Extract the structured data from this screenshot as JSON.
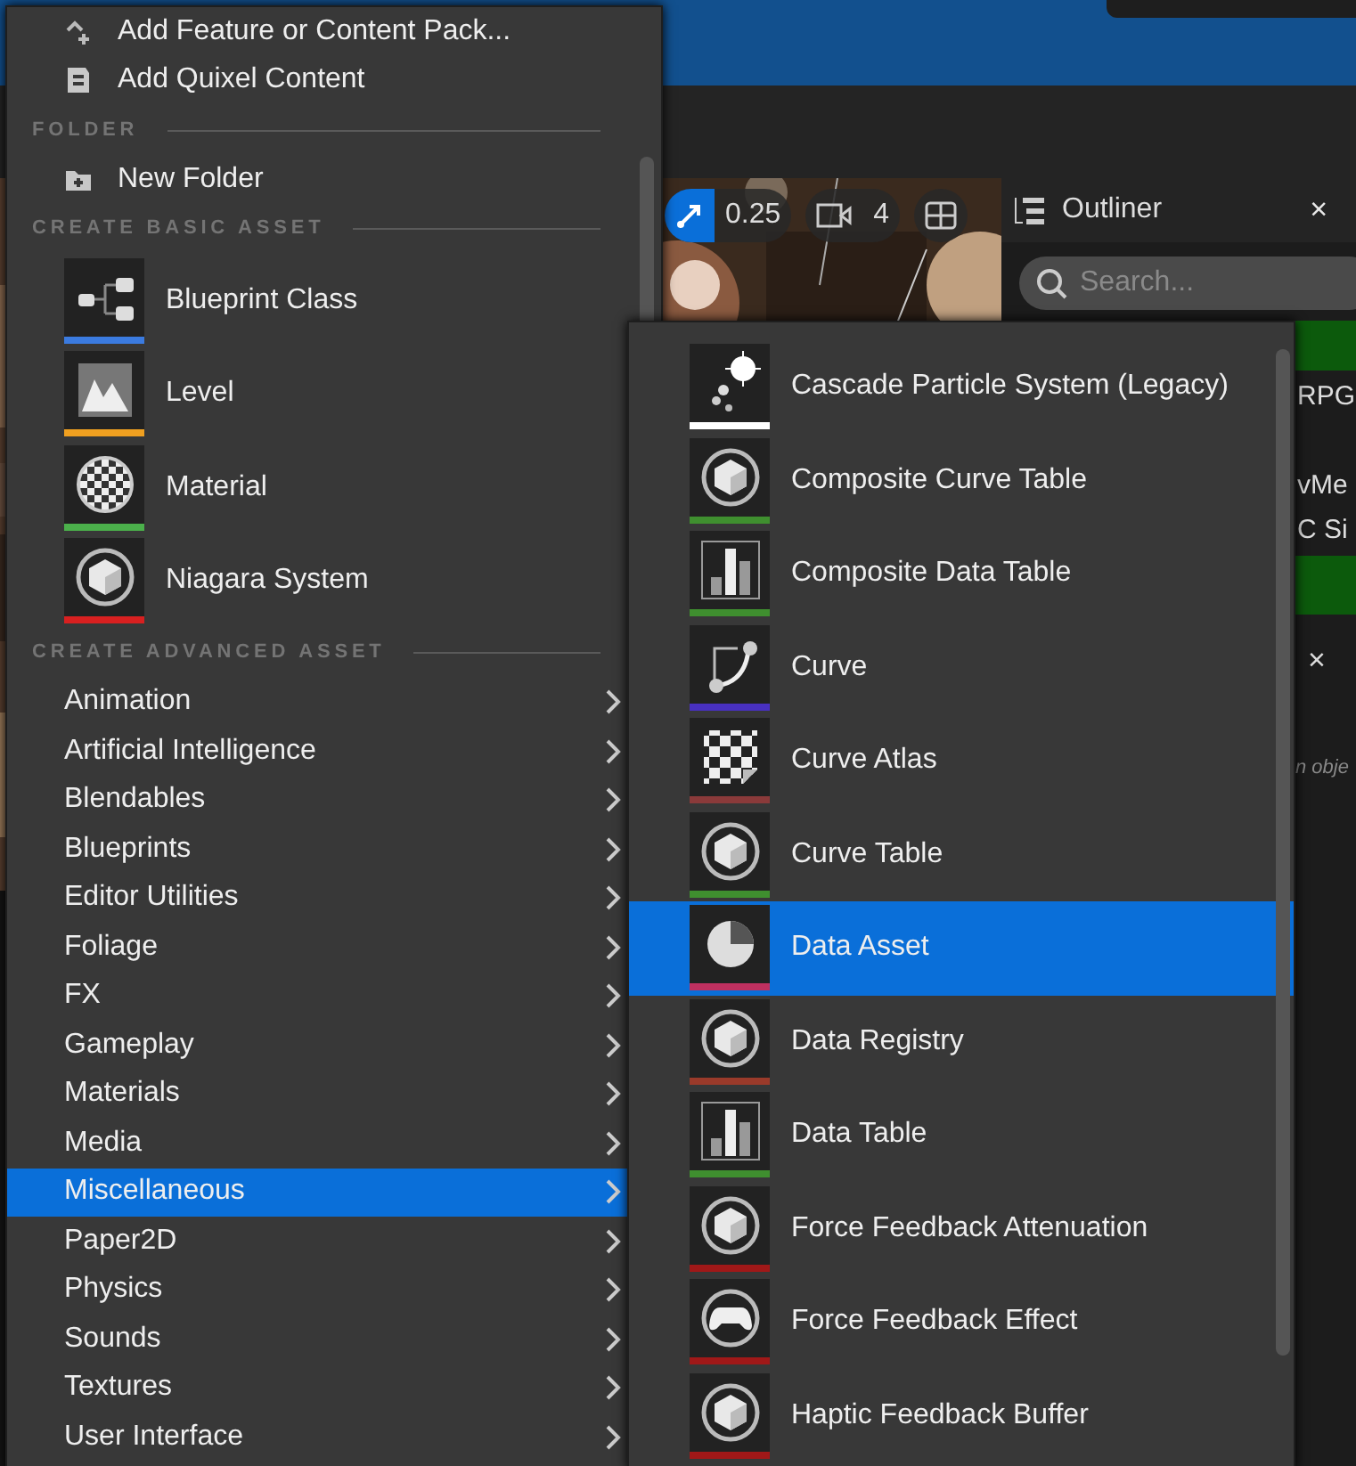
{
  "viewport_toolbar": {
    "snap_enabled": true,
    "snap_value": "0.25",
    "camera_speed": "4"
  },
  "outliner": {
    "title": "Outliner",
    "close": "×",
    "search_placeholder": "Search...",
    "rows": [
      {
        "text": "RPG"
      },
      {
        "text": "vMe"
      },
      {
        "text": "C Si"
      }
    ],
    "details_close": "×",
    "details_hint": "n obje"
  },
  "context_menu": {
    "sections": [
      {
        "items": [
          {
            "kind": "action",
            "label": "Add Feature or Content Pack..."
          },
          {
            "kind": "action",
            "label": "Add Quixel Content"
          }
        ]
      },
      {
        "header": "FOLDER",
        "items": [
          {
            "kind": "action",
            "label": "New Folder"
          }
        ]
      },
      {
        "header": "CREATE BASIC ASSET",
        "items": [
          {
            "kind": "asset",
            "label": "Blueprint Class",
            "color": "#3b7be0"
          },
          {
            "kind": "asset",
            "label": "Level",
            "color": "#f0a020"
          },
          {
            "kind": "asset",
            "label": "Material",
            "color": "#4bb04b"
          },
          {
            "kind": "asset",
            "label": "Niagara System",
            "color": "#d82020"
          }
        ]
      },
      {
        "header": "CREATE ADVANCED ASSET",
        "items": [
          {
            "kind": "submenu",
            "label": "Animation",
            "selected": false
          },
          {
            "kind": "submenu",
            "label": "Artificial Intelligence",
            "selected": false
          },
          {
            "kind": "submenu",
            "label": "Blendables",
            "selected": false
          },
          {
            "kind": "submenu",
            "label": "Blueprints",
            "selected": false
          },
          {
            "kind": "submenu",
            "label": "Editor Utilities",
            "selected": false
          },
          {
            "kind": "submenu",
            "label": "Foliage",
            "selected": false
          },
          {
            "kind": "submenu",
            "label": "FX",
            "selected": false
          },
          {
            "kind": "submenu",
            "label": "Gameplay",
            "selected": false
          },
          {
            "kind": "submenu",
            "label": "Materials",
            "selected": false
          },
          {
            "kind": "submenu",
            "label": "Media",
            "selected": false
          },
          {
            "kind": "submenu",
            "label": "Miscellaneous",
            "selected": true
          },
          {
            "kind": "submenu",
            "label": "Paper2D",
            "selected": false
          },
          {
            "kind": "submenu",
            "label": "Physics",
            "selected": false
          },
          {
            "kind": "submenu",
            "label": "Sounds",
            "selected": false
          },
          {
            "kind": "submenu",
            "label": "Textures",
            "selected": false
          },
          {
            "kind": "submenu",
            "label": "User Interface",
            "selected": false
          }
        ]
      }
    ]
  },
  "submenu": {
    "items": [
      {
        "label": "Cascade Particle System (Legacy)",
        "color": "#ffffff",
        "selected": false
      },
      {
        "label": "Composite Curve Table",
        "color": "#3f8f2f",
        "selected": false
      },
      {
        "label": "Composite Data Table",
        "color": "#3f8f2f",
        "selected": false
      },
      {
        "label": "Curve",
        "color": "#4830c0",
        "selected": false
      },
      {
        "label": "Curve Atlas",
        "color": "#8a3a3a",
        "selected": false
      },
      {
        "label": "Curve Table",
        "color": "#3f8f2f",
        "selected": false
      },
      {
        "label": "Data Asset",
        "color": "#c03060",
        "selected": true
      },
      {
        "label": "Data Registry",
        "color": "#9a3a2a",
        "selected": false
      },
      {
        "label": "Data Table",
        "color": "#3f8f2f",
        "selected": false
      },
      {
        "label": "Force Feedback Attenuation",
        "color": "#a01818",
        "selected": false
      },
      {
        "label": "Force Feedback Effect",
        "color": "#a01818",
        "selected": false
      },
      {
        "label": "Haptic Feedback Buffer",
        "color": "#a01818",
        "selected": false
      }
    ]
  }
}
